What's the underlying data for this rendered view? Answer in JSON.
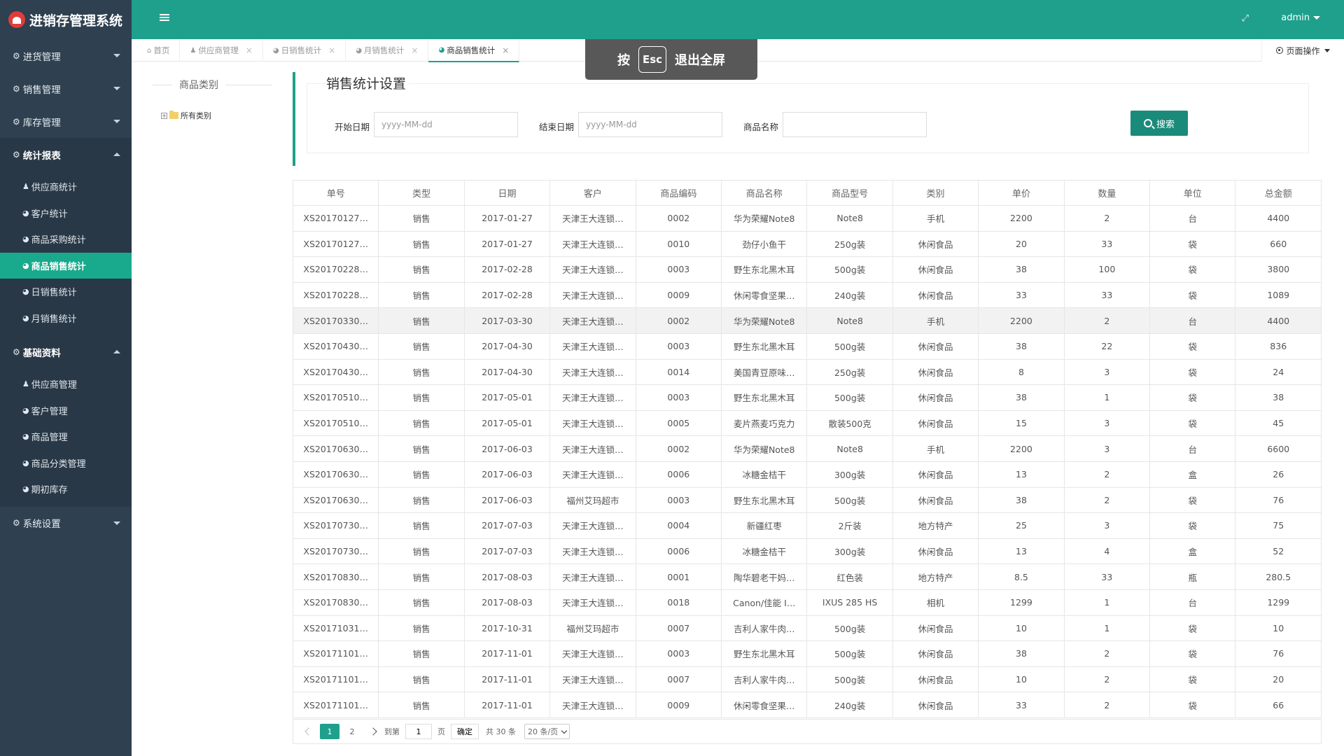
{
  "app": {
    "title": "进销存管理系统"
  },
  "sidebar": {
    "groups": [
      {
        "label": "进货管理",
        "open": false,
        "items": []
      },
      {
        "label": "销售管理",
        "open": false,
        "items": []
      },
      {
        "label": "库存管理",
        "open": false,
        "items": []
      },
      {
        "label": "统计报表",
        "open": true,
        "items": [
          {
            "label": "供应商统计",
            "icon": "user-icon"
          },
          {
            "label": "客户统计",
            "icon": "dashboard-icon"
          },
          {
            "label": "商品采购统计",
            "icon": "dashboard-icon"
          },
          {
            "label": "商品销售统计",
            "icon": "dashboard-icon",
            "active": true
          },
          {
            "label": "日销售统计",
            "icon": "dashboard-icon"
          },
          {
            "label": "月销售统计",
            "icon": "dashboard-icon"
          }
        ]
      },
      {
        "label": "基础资料",
        "open": true,
        "items": [
          {
            "label": "供应商管理",
            "icon": "user-icon"
          },
          {
            "label": "客户管理",
            "icon": "dashboard-icon"
          },
          {
            "label": "商品管理",
            "icon": "dashboard-icon"
          },
          {
            "label": "商品分类管理",
            "icon": "dashboard-icon"
          },
          {
            "label": "期初库存",
            "icon": "dashboard-icon"
          }
        ]
      },
      {
        "label": "系统设置",
        "open": false,
        "items": []
      }
    ]
  },
  "header": {
    "user": "admin"
  },
  "tabs": [
    {
      "label": "首页",
      "closable": false,
      "active": false
    },
    {
      "label": "供应商管理",
      "closable": true,
      "active": false
    },
    {
      "label": "日销售统计",
      "closable": true,
      "active": false
    },
    {
      "label": "月销售统计",
      "closable": true,
      "active": false
    },
    {
      "label": "商品销售统计",
      "closable": true,
      "active": true
    }
  ],
  "page_ops": {
    "label": "页面操作"
  },
  "toast": {
    "prefix": "按",
    "key": "Esc",
    "suffix": "退出全屏"
  },
  "category_panel": {
    "title": "商品类别",
    "root": "所有类别"
  },
  "settings": {
    "legend": "销售统计设置",
    "start_label": "开始日期",
    "start_placeholder": "yyyy-MM-dd",
    "end_label": "结束日期",
    "end_placeholder": "yyyy-MM-dd",
    "name_label": "商品名称",
    "name_value": "",
    "search_label": "搜索"
  },
  "table": {
    "columns": [
      "单号",
      "类型",
      "日期",
      "客户",
      "商品编码",
      "商品名称",
      "商品型号",
      "类别",
      "单价",
      "数量",
      "单位",
      "总金额"
    ],
    "rows": [
      [
        "XS20170127…",
        "销售",
        "2017-01-27",
        "天津王大连锁…",
        "0002",
        "华为荣耀Note8",
        "Note8",
        "手机",
        "2200",
        "2",
        "台",
        "4400"
      ],
      [
        "XS20170127…",
        "销售",
        "2017-01-27",
        "天津王大连锁…",
        "0010",
        "劲仔小鱼干",
        "250g装",
        "休闲食品",
        "20",
        "33",
        "袋",
        "660"
      ],
      [
        "XS20170228…",
        "销售",
        "2017-02-28",
        "天津王大连锁…",
        "0003",
        "野生东北黑木耳",
        "500g装",
        "休闲食品",
        "38",
        "100",
        "袋",
        "3800"
      ],
      [
        "XS20170228…",
        "销售",
        "2017-02-28",
        "天津王大连锁…",
        "0009",
        "休闲零食坚果…",
        "240g装",
        "休闲食品",
        "33",
        "33",
        "袋",
        "1089"
      ],
      [
        "XS20170330…",
        "销售",
        "2017-03-30",
        "天津王大连锁…",
        "0002",
        "华为荣耀Note8",
        "Note8",
        "手机",
        "2200",
        "2",
        "台",
        "4400"
      ],
      [
        "XS20170430…",
        "销售",
        "2017-04-30",
        "天津王大连锁…",
        "0003",
        "野生东北黑木耳",
        "500g装",
        "休闲食品",
        "38",
        "22",
        "袋",
        "836"
      ],
      [
        "XS20170430…",
        "销售",
        "2017-04-30",
        "天津王大连锁…",
        "0014",
        "美国青豆原味…",
        "250g装",
        "休闲食品",
        "8",
        "3",
        "袋",
        "24"
      ],
      [
        "XS20170510…",
        "销售",
        "2017-05-01",
        "天津王大连锁…",
        "0003",
        "野生东北黑木耳",
        "500g装",
        "休闲食品",
        "38",
        "1",
        "袋",
        "38"
      ],
      [
        "XS20170510…",
        "销售",
        "2017-05-01",
        "天津王大连锁…",
        "0005",
        "麦片燕麦巧克力",
        "散装500克",
        "休闲食品",
        "15",
        "3",
        "袋",
        "45"
      ],
      [
        "XS20170630…",
        "销售",
        "2017-06-03",
        "天津王大连锁…",
        "0002",
        "华为荣耀Note8",
        "Note8",
        "手机",
        "2200",
        "3",
        "台",
        "6600"
      ],
      [
        "XS20170630…",
        "销售",
        "2017-06-03",
        "天津王大连锁…",
        "0006",
        "冰糖金桔干",
        "300g装",
        "休闲食品",
        "13",
        "2",
        "盒",
        "26"
      ],
      [
        "XS20170630…",
        "销售",
        "2017-06-03",
        "福州艾玛超市",
        "0003",
        "野生东北黑木耳",
        "500g装",
        "休闲食品",
        "38",
        "2",
        "袋",
        "76"
      ],
      [
        "XS20170730…",
        "销售",
        "2017-07-03",
        "天津王大连锁…",
        "0004",
        "新疆红枣",
        "2斤装",
        "地方特产",
        "25",
        "3",
        "袋",
        "75"
      ],
      [
        "XS20170730…",
        "销售",
        "2017-07-03",
        "天津王大连锁…",
        "0006",
        "冰糖金桔干",
        "300g装",
        "休闲食品",
        "13",
        "4",
        "盒",
        "52"
      ],
      [
        "XS20170830…",
        "销售",
        "2017-08-03",
        "天津王大连锁…",
        "0001",
        "陶华碧老干妈…",
        "红色装",
        "地方特产",
        "8.5",
        "33",
        "瓶",
        "280.5"
      ],
      [
        "XS20170830…",
        "销售",
        "2017-08-03",
        "天津王大连锁…",
        "0018",
        "Canon/佳能 I…",
        "IXUS 285 HS",
        "相机",
        "1299",
        "1",
        "台",
        "1299"
      ],
      [
        "XS20171031…",
        "销售",
        "2017-10-31",
        "福州艾玛超市",
        "0007",
        "吉利人家牛肉…",
        "500g装",
        "休闲食品",
        "10",
        "1",
        "袋",
        "10"
      ],
      [
        "XS20171101…",
        "销售",
        "2017-11-01",
        "天津王大连锁…",
        "0003",
        "野生东北黑木耳",
        "500g装",
        "休闲食品",
        "38",
        "2",
        "袋",
        "76"
      ],
      [
        "XS20171101…",
        "销售",
        "2017-11-01",
        "天津王大连锁…",
        "0007",
        "吉利人家牛肉…",
        "500g装",
        "休闲食品",
        "10",
        "2",
        "袋",
        "20"
      ],
      [
        "XS20171101…",
        "销售",
        "2017-11-01",
        "天津王大连锁…",
        "0009",
        "休闲零食坚果…",
        "240g装",
        "休闲食品",
        "33",
        "2",
        "袋",
        "66"
      ]
    ],
    "highlighted_row": 4
  },
  "pager": {
    "pages": [
      "1",
      "2"
    ],
    "current": "1",
    "goto_label": "到第",
    "goto_value": "1",
    "page_unit": "页",
    "ok_label": "确定",
    "total_label": "共 30 条",
    "page_size": "20 条/页"
  }
}
